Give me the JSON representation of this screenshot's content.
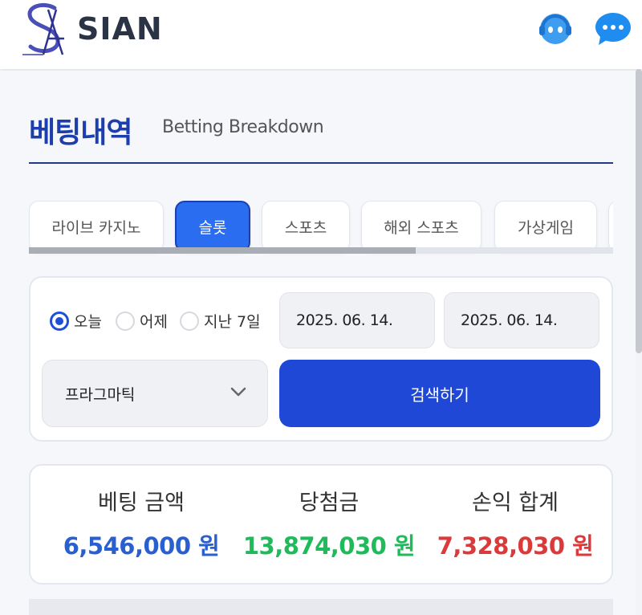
{
  "header": {
    "brand": "SIAN",
    "support_icon": "support-agent-icon",
    "chat_icon": "chat-bubble-icon"
  },
  "page": {
    "title": "베팅내역",
    "subtitle": "Betting Breakdown"
  },
  "tabs": [
    {
      "label": "라이브 카지노",
      "active": false
    },
    {
      "label": "슬롯",
      "active": true
    },
    {
      "label": "스포츠",
      "active": false
    },
    {
      "label": "해외 스포츠",
      "active": false
    },
    {
      "label": "가상게임",
      "active": false
    },
    {
      "label": "",
      "active": false
    }
  ],
  "filter": {
    "periods": [
      {
        "label": "오늘",
        "checked": true
      },
      {
        "label": "어제",
        "checked": false
      },
      {
        "label": "지난 7일",
        "checked": false
      }
    ],
    "start_date": "2025. 06. 14.",
    "end_date": "2025. 06. 14.",
    "provider": "프라그마틱",
    "search_label": "검색하기"
  },
  "summary": {
    "bet_label": "베팅 금액",
    "bet_value": "6,546,000 원",
    "win_label": "당첨금",
    "win_value": "13,874,030 원",
    "profit_label": "손익 합계",
    "profit_value": "7,328,030 원"
  },
  "colors": {
    "primary": "#1d3fae",
    "button": "#1f48d6",
    "active_tab": "#2a6df0",
    "bet": "#2a5fd0",
    "win": "#1fba5a",
    "profit": "#dc3a3a"
  }
}
